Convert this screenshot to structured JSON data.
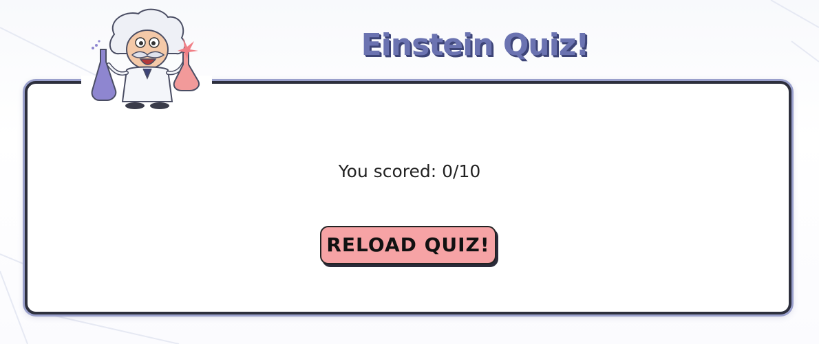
{
  "header": {
    "title": "Einstein Quiz!"
  },
  "result": {
    "score_text": "You scored: 0/10"
  },
  "actions": {
    "reload_label": "RELOAD QUIZ!"
  },
  "colors": {
    "title": "#6b73b1",
    "title_shadow": "#3d4477",
    "card_border": "#2d2f3d",
    "card_glow": "#9aa0cc",
    "button_bg": "#f6a3a5"
  },
  "icons": {
    "mascot": "einstein-scientist-mascot"
  }
}
